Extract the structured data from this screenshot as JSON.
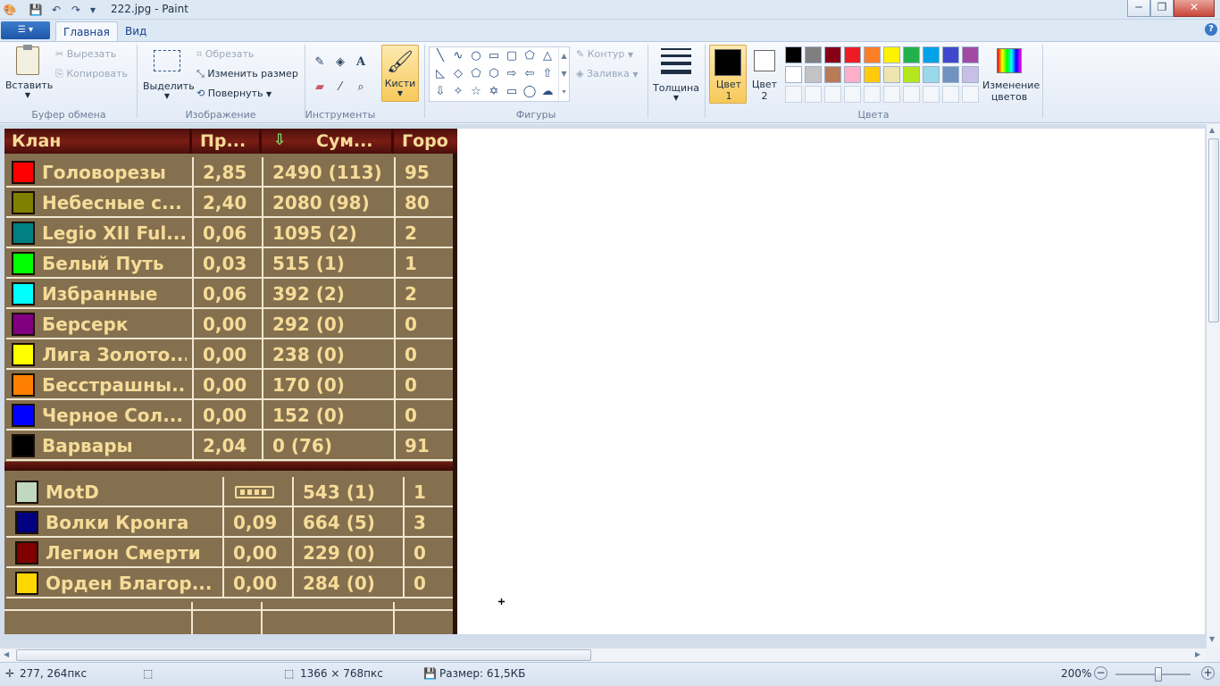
{
  "window": {
    "title": "222.jpg - Paint",
    "minimize": "─",
    "maximize": "❐",
    "close": "✕"
  },
  "tabs": {
    "home": "Главная",
    "view": "Вид"
  },
  "ribbon": {
    "clipboard": {
      "paste": "Вставить",
      "cut": "Вырезать",
      "copy": "Копировать",
      "group": "Буфер обмена"
    },
    "image": {
      "select": "Выделить",
      "crop": "Обрезать",
      "resize": "Изменить размер",
      "rotate": "Повернуть",
      "group": "Изображение"
    },
    "tools": {
      "group": "Инструменты"
    },
    "brushes": "Кисти",
    "shapes": {
      "outline": "Контур",
      "fill": "Заливка",
      "group": "Фигуры"
    },
    "thickness": "Толщина",
    "colors": {
      "color1": "Цвет 1",
      "color2": "Цвет 2",
      "edit": "Изменение цветов",
      "group": "Цвета",
      "color1_value": "#000000",
      "color2_value": "#ffffff",
      "palette_row1": [
        "#000000",
        "#7f7f7f",
        "#880015",
        "#ed1c24",
        "#ff7f27",
        "#fff200",
        "#22b14c",
        "#00a2e8",
        "#3f48cc",
        "#a349a4"
      ],
      "palette_row2": [
        "#ffffff",
        "#c3c3c3",
        "#b97a57",
        "#ffaec9",
        "#ffc90e",
        "#efe4b0",
        "#b5e61d",
        "#99d9ea",
        "#7092be",
        "#c8bfe7"
      ]
    }
  },
  "game_table": {
    "headers": [
      "Клан",
      "Пр...",
      "Сум...",
      "Горо"
    ],
    "sort_icon": "sort-down-arrow",
    "rows": [
      {
        "color": "#ff0000",
        "clan": "Головорезы",
        "pr": "2,85",
        "sum": "2490 (113)",
        "city": "95"
      },
      {
        "color": "#808000",
        "clan": "Небесные с...",
        "pr": "2,40",
        "sum": "2080 (98)",
        "city": "80"
      },
      {
        "color": "#008080",
        "clan": "Legio XII Ful...",
        "pr": "0,06",
        "sum": "1095 (2)",
        "city": "2"
      },
      {
        "color": "#00ff00",
        "clan": "Белый Путь",
        "pr": "0,03",
        "sum": "515 (1)",
        "city": "1"
      },
      {
        "color": "#00ffff",
        "clan": "Избранные",
        "pr": "0,06",
        "sum": "392 (2)",
        "city": "2"
      },
      {
        "color": "#800080",
        "clan": "Берсерк",
        "pr": "0,00",
        "sum": "292 (0)",
        "city": "0"
      },
      {
        "color": "#ffff00",
        "clan": "Лига Золото...",
        "pr": "0,00",
        "sum": "238 (0)",
        "city": "0"
      },
      {
        "color": "#ff8000",
        "clan": "Бесстрашны...",
        "pr": "0,00",
        "sum": "170 (0)",
        "city": "0"
      },
      {
        "color": "#0000ff",
        "clan": "Черное Сол...",
        "pr": "0,00",
        "sum": "152 (0)",
        "city": "0"
      },
      {
        "color": "#000000",
        "clan": "Варвары",
        "pr": "2,04",
        "sum": "0 (76)",
        "city": "91"
      }
    ],
    "rows2": [
      {
        "color": "#c0d8c0",
        "clan": "MotD",
        "pr": "",
        "pr_icon": "battery-icon",
        "sum": "543 (1)",
        "city": "1"
      },
      {
        "color": "#000080",
        "clan": "Волки Кронга",
        "pr": "0,09",
        "sum": "664 (5)",
        "city": "3"
      },
      {
        "color": "#800000",
        "clan": "Легион Смерти",
        "pr": "0,00",
        "sum": "229 (0)",
        "city": "0"
      },
      {
        "color": "#ffd700",
        "clan": "Орден Благор...",
        "pr": "0,00",
        "sum": "284 (0)",
        "city": "0"
      }
    ]
  },
  "status": {
    "cursor_pos": "277, 264пкс",
    "dimensions": "1366 × 768пкс",
    "size": "Размер: 61,5КБ",
    "zoom": "200%"
  }
}
